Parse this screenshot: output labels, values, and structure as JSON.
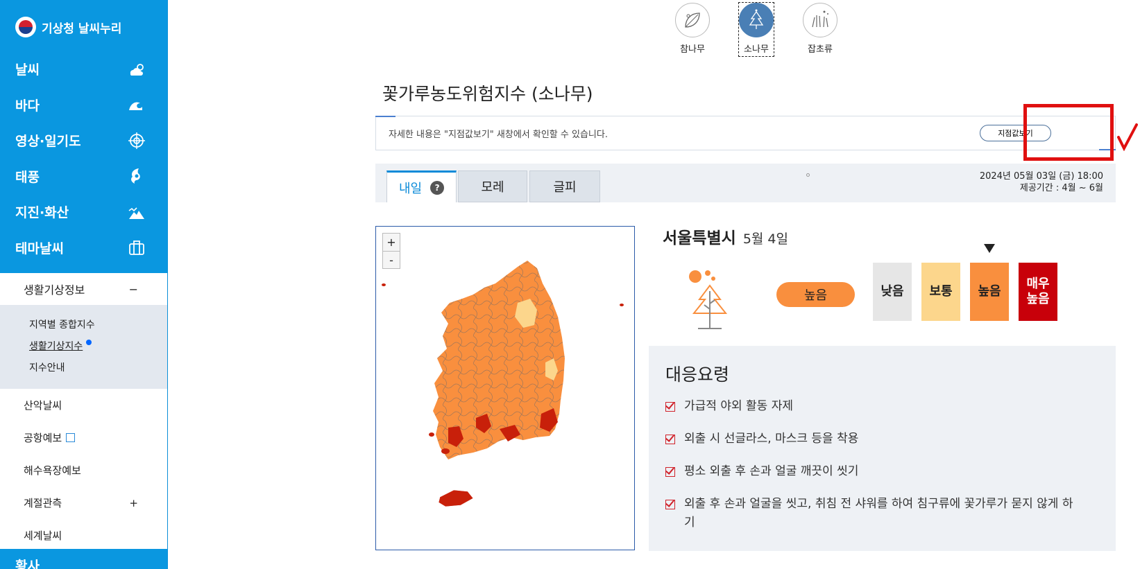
{
  "brand": {
    "title": "기상청 날씨누리"
  },
  "nav": {
    "items": [
      {
        "label": "날씨",
        "icon": "weather-icon"
      },
      {
        "label": "바다",
        "icon": "wave-icon"
      },
      {
        "label": "영상·일기도",
        "icon": "satellite-icon"
      },
      {
        "label": "태풍",
        "icon": "typhoon-icon"
      },
      {
        "label": "지진·화산",
        "icon": "earthquake-icon"
      },
      {
        "label": "테마날씨",
        "icon": "bag-icon"
      }
    ],
    "open_sub": {
      "label": "생활기상정보",
      "toggle": "−"
    },
    "subsub": [
      "지역별 종합지수",
      "생활기상지수",
      "지수안내"
    ],
    "sub_items": [
      {
        "label": "산악날씨",
        "suffix": ""
      },
      {
        "label": "공항예보",
        "suffix": ""
      },
      {
        "label": "해수욕장예보",
        "suffix": ""
      },
      {
        "label": "계절관측",
        "suffix": "+"
      },
      {
        "label": "세계날씨",
        "suffix": ""
      }
    ],
    "bottom_label": "황사"
  },
  "plants": [
    {
      "name": "참나무",
      "selected": false
    },
    {
      "name": "소나무",
      "selected": true
    },
    {
      "name": "잡초류",
      "selected": false
    }
  ],
  "page_title": "꽃가루농도위험지수 (소나무)",
  "info": {
    "text": "자세한 내용은 \"지점값보기\" 새창에서 확인할 수 있습니다.",
    "button": "지점값보기"
  },
  "day_tabs": {
    "tab1": "내일",
    "tab2": "모레",
    "tab3": "글피",
    "help": "?"
  },
  "meta": {
    "issued": "2024년 05월 03일 (금) 18:00",
    "period": "제공기간 : 4월 ~ 6월"
  },
  "map": {
    "zoom_in": "+",
    "zoom_out": "-"
  },
  "region": {
    "name": "서울특별시",
    "date": "5월 4일"
  },
  "level": {
    "current": "높음"
  },
  "scale": [
    {
      "label": "낮음",
      "color": "#e6e6e6",
      "text_color": "#222222"
    },
    {
      "label": "보통",
      "color": "#fcd68c",
      "text_color": "#222222"
    },
    {
      "label": "높음",
      "color": "#f98f3e",
      "text_color": "#222222"
    },
    {
      "label": "매우\n높음",
      "color": "#c8000a",
      "text_color": "#ffffff"
    }
  ],
  "guide": {
    "title": "대응요령",
    "items": [
      "가급적 야외 활동 자제",
      "외출 시 선글라스, 마스크 등을 착용",
      "평소 외출 후 손과 얼굴 깨끗이 씻기",
      "외출 후 손과 얼굴을 씻고, 취침 전 샤워를 하여 침구류에 꽃가루가 묻지 않게 하기"
    ]
  },
  "colors": {
    "sidebar": "#0a97e0",
    "accent": "#0a8ad8",
    "high": "#f98f3e",
    "very_high": "#c8000a",
    "annotation": "#e01010"
  }
}
